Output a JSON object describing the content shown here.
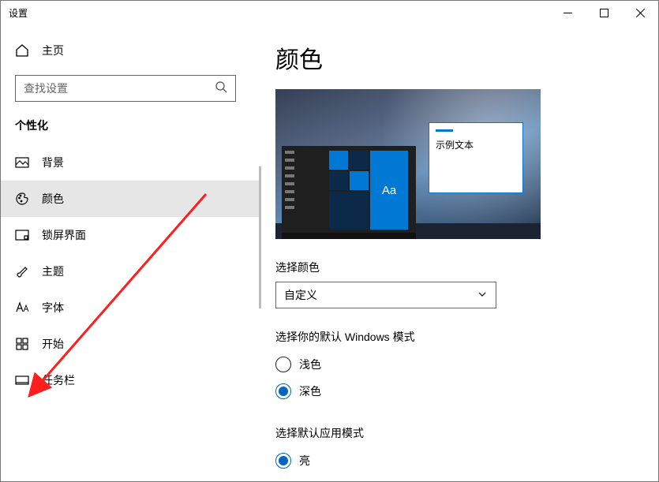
{
  "window": {
    "title": "设置"
  },
  "sidebar": {
    "home": "主页",
    "search_placeholder": "查找设置",
    "section": "个性化",
    "items": [
      {
        "label": "背景"
      },
      {
        "label": "颜色"
      },
      {
        "label": "锁屏界面"
      },
      {
        "label": "主题"
      },
      {
        "label": "字体"
      },
      {
        "label": "开始"
      },
      {
        "label": "任务栏"
      }
    ]
  },
  "content": {
    "heading": "颜色",
    "sample_text": "示例文本",
    "preview_tile_label": "Aa",
    "choose_color_label": "选择颜色",
    "color_mode_value": "自定义",
    "windows_mode_label": "选择你的默认 Windows 模式",
    "windows_mode_options": {
      "light": "浅色",
      "dark": "深色"
    },
    "windows_mode_selected": "dark",
    "app_mode_label": "选择默认应用模式",
    "app_mode_options": {
      "light": "亮"
    },
    "app_mode_selected": "light"
  }
}
